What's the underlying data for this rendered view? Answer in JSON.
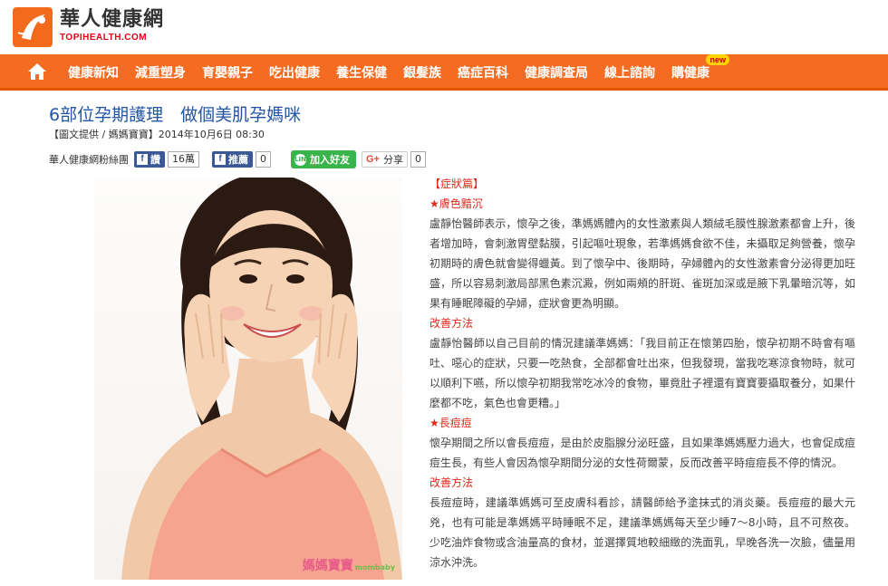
{
  "header": {
    "logo_title": "華人健康網",
    "logo_sub": "TOPIHEALTH.COM"
  },
  "nav": {
    "items": [
      "健康新知",
      "減重塑身",
      "育嬰親子",
      "吃出健康",
      "養生保健",
      "銀髮族",
      "癌症百科",
      "健康調查局",
      "線上諮詢",
      "購健康"
    ],
    "new_badge": "new"
  },
  "article": {
    "title": "6部位孕期護理　做個美肌孕媽咪",
    "meta": "【圖文提供 / 媽媽寶寶】2014年10月6日 08:30",
    "share": {
      "fan_label": "華人健康網粉絲團",
      "fb_like_label": "讚",
      "fb_like_count": "16萬",
      "fb_recommend_label": "推薦",
      "fb_recommend_count": "0",
      "line_label": "加入好友",
      "line_icon_text": "LINE",
      "gplus_g": "G+",
      "gplus_label": "分享",
      "gplus_count": "0"
    },
    "photo_brand": "媽媽寶寶",
    "photo_brand_sub": "mombaby",
    "section_title": "【症狀篇】",
    "blocks": [
      {
        "type": "sub",
        "text": "★膚色黯沉"
      },
      {
        "type": "para",
        "text": "盧靜怡醫師表示，懷孕之後，準媽媽體內的女性激素與人類絨毛膜性腺激素都會上升，後者增加時，會刺激胃壁黏膜，引起嘔吐現象，若準媽媽食欲不佳，未攝取足夠營養，懷孕初期時的膚色就會變得蠟黃。到了懷孕中、後期時，孕婦體內的女性激素會分泌得更加旺盛，所以容易刺激局部黑色素沉澱，例如兩頰的肝斑、雀斑加深或是腋下乳暈暗沉等，如果有睡眠障礙的孕婦，症狀會更為明顯。"
      },
      {
        "type": "fix",
        "text": "改善方法"
      },
      {
        "type": "para",
        "text": "盧靜怡醫師以自己目前的情況建議準媽媽：「我目前正在懷第四胎，懷孕初期不時會有嘔吐、噁心的症狀，只要一吃熱食，全部都會吐出來，但我發現，當我吃寒涼食物時，就可以順利下嚥，所以懷孕初期我常吃冰冷的食物，畢竟肚子裡還有寶寶要攝取養分，如果什麼都不吃，氣色也會更糟。」"
      },
      {
        "type": "sub",
        "text": "★長痘痘"
      },
      {
        "type": "para",
        "text": "懷孕期間之所以會長痘痘，是由於皮脂腺分泌旺盛，且如果準媽媽壓力過大，也會促成痘痘生長，有些人會因為懷孕期間分泌的女性荷爾蒙，反而改善平時痘痘長不停的情況。"
      },
      {
        "type": "fix",
        "text": "改善方法"
      },
      {
        "type": "para",
        "text": "長痘痘時，建議準媽媽可至皮膚科看診，請醫師給予塗抹式的消炎藥。長痘痘的最大元兇，也有可能是準媽媽平時睡眠不足，建議準媽媽每天至少睡7～8小時，且不可熬夜。少吃油炸食物或含油量高的食材，並選擇質地較細緻的洗面乳，早晚各洗一次臉，儘量用涼水沖洗。"
      }
    ]
  },
  "colors": {
    "brand_orange": "#f36c21",
    "title_blue": "#2255a4",
    "accent_red": "#e0281b",
    "facebook_blue": "#3b5998",
    "line_green": "#39b44a"
  }
}
